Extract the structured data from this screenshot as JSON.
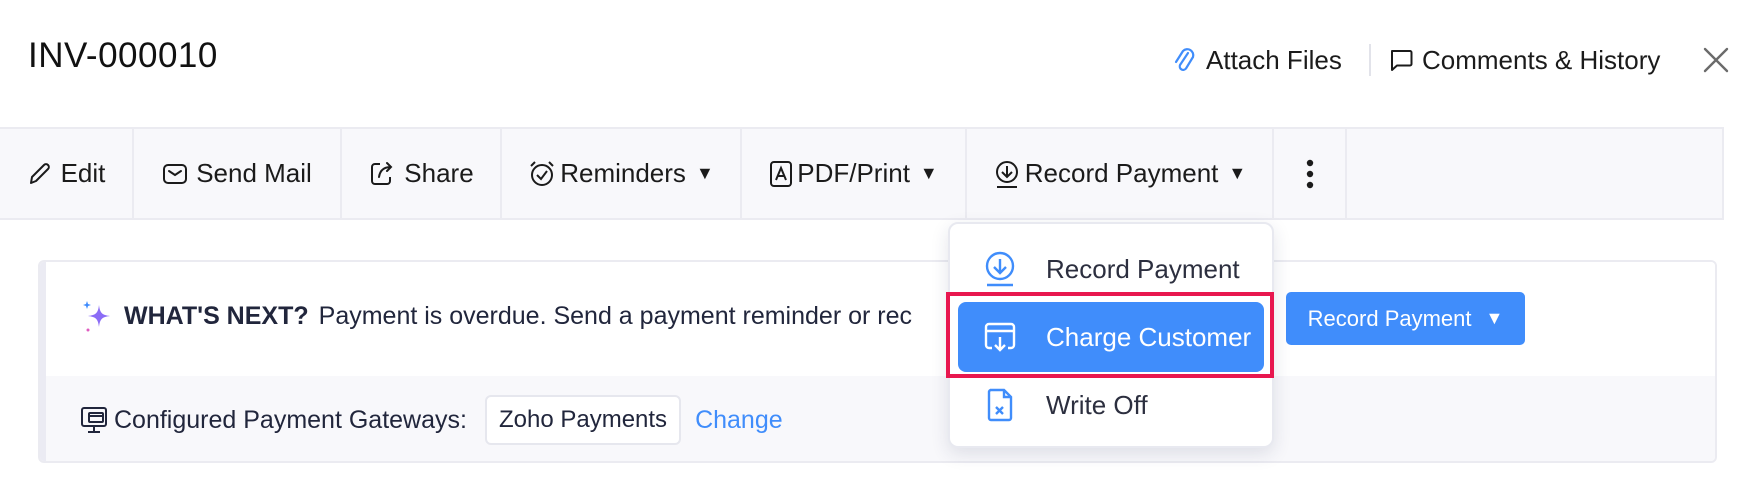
{
  "header": {
    "title": "INV-000010",
    "attach_files": "Attach Files",
    "comments_history": "Comments & History",
    "close_icon": "close-icon"
  },
  "toolbar": {
    "items": [
      {
        "label": "Edit",
        "icon": "pencil-icon",
        "has_caret": false
      },
      {
        "label": "Send Mail",
        "icon": "mail-icon",
        "has_caret": false
      },
      {
        "label": "Share",
        "icon": "share-icon",
        "has_caret": false
      },
      {
        "label": "Reminders",
        "icon": "alarm-clock-icon",
        "has_caret": true
      },
      {
        "label": "PDF/Print",
        "icon": "pdf-icon",
        "has_caret": true
      },
      {
        "label": "Record Payment",
        "icon": "download-circle-icon",
        "has_caret": true
      }
    ],
    "caret": "▼",
    "more_icon": "more-vertical-icon"
  },
  "whats_next": {
    "heading": "WHAT'S NEXT?",
    "message": "Payment is overdue. Send a payment reminder or rec",
    "button_label": "Record Payment",
    "button_caret": "▼"
  },
  "gateways": {
    "label": "Configured Payment Gateways:",
    "value": "Zoho Payments",
    "change_link": "Change"
  },
  "record_payment_menu": {
    "items": [
      {
        "label": "Record Payment",
        "icon": "download-circle-icon",
        "active": false
      },
      {
        "label": "Charge Customer",
        "icon": "card-download-icon",
        "active": true
      },
      {
        "label": "Write Off",
        "icon": "file-x-icon",
        "active": false
      }
    ]
  },
  "colors": {
    "accent": "#408dfb",
    "highlight_border": "#e8174f",
    "toolbar_bg": "#f8f8fb",
    "text": "#21263c"
  }
}
